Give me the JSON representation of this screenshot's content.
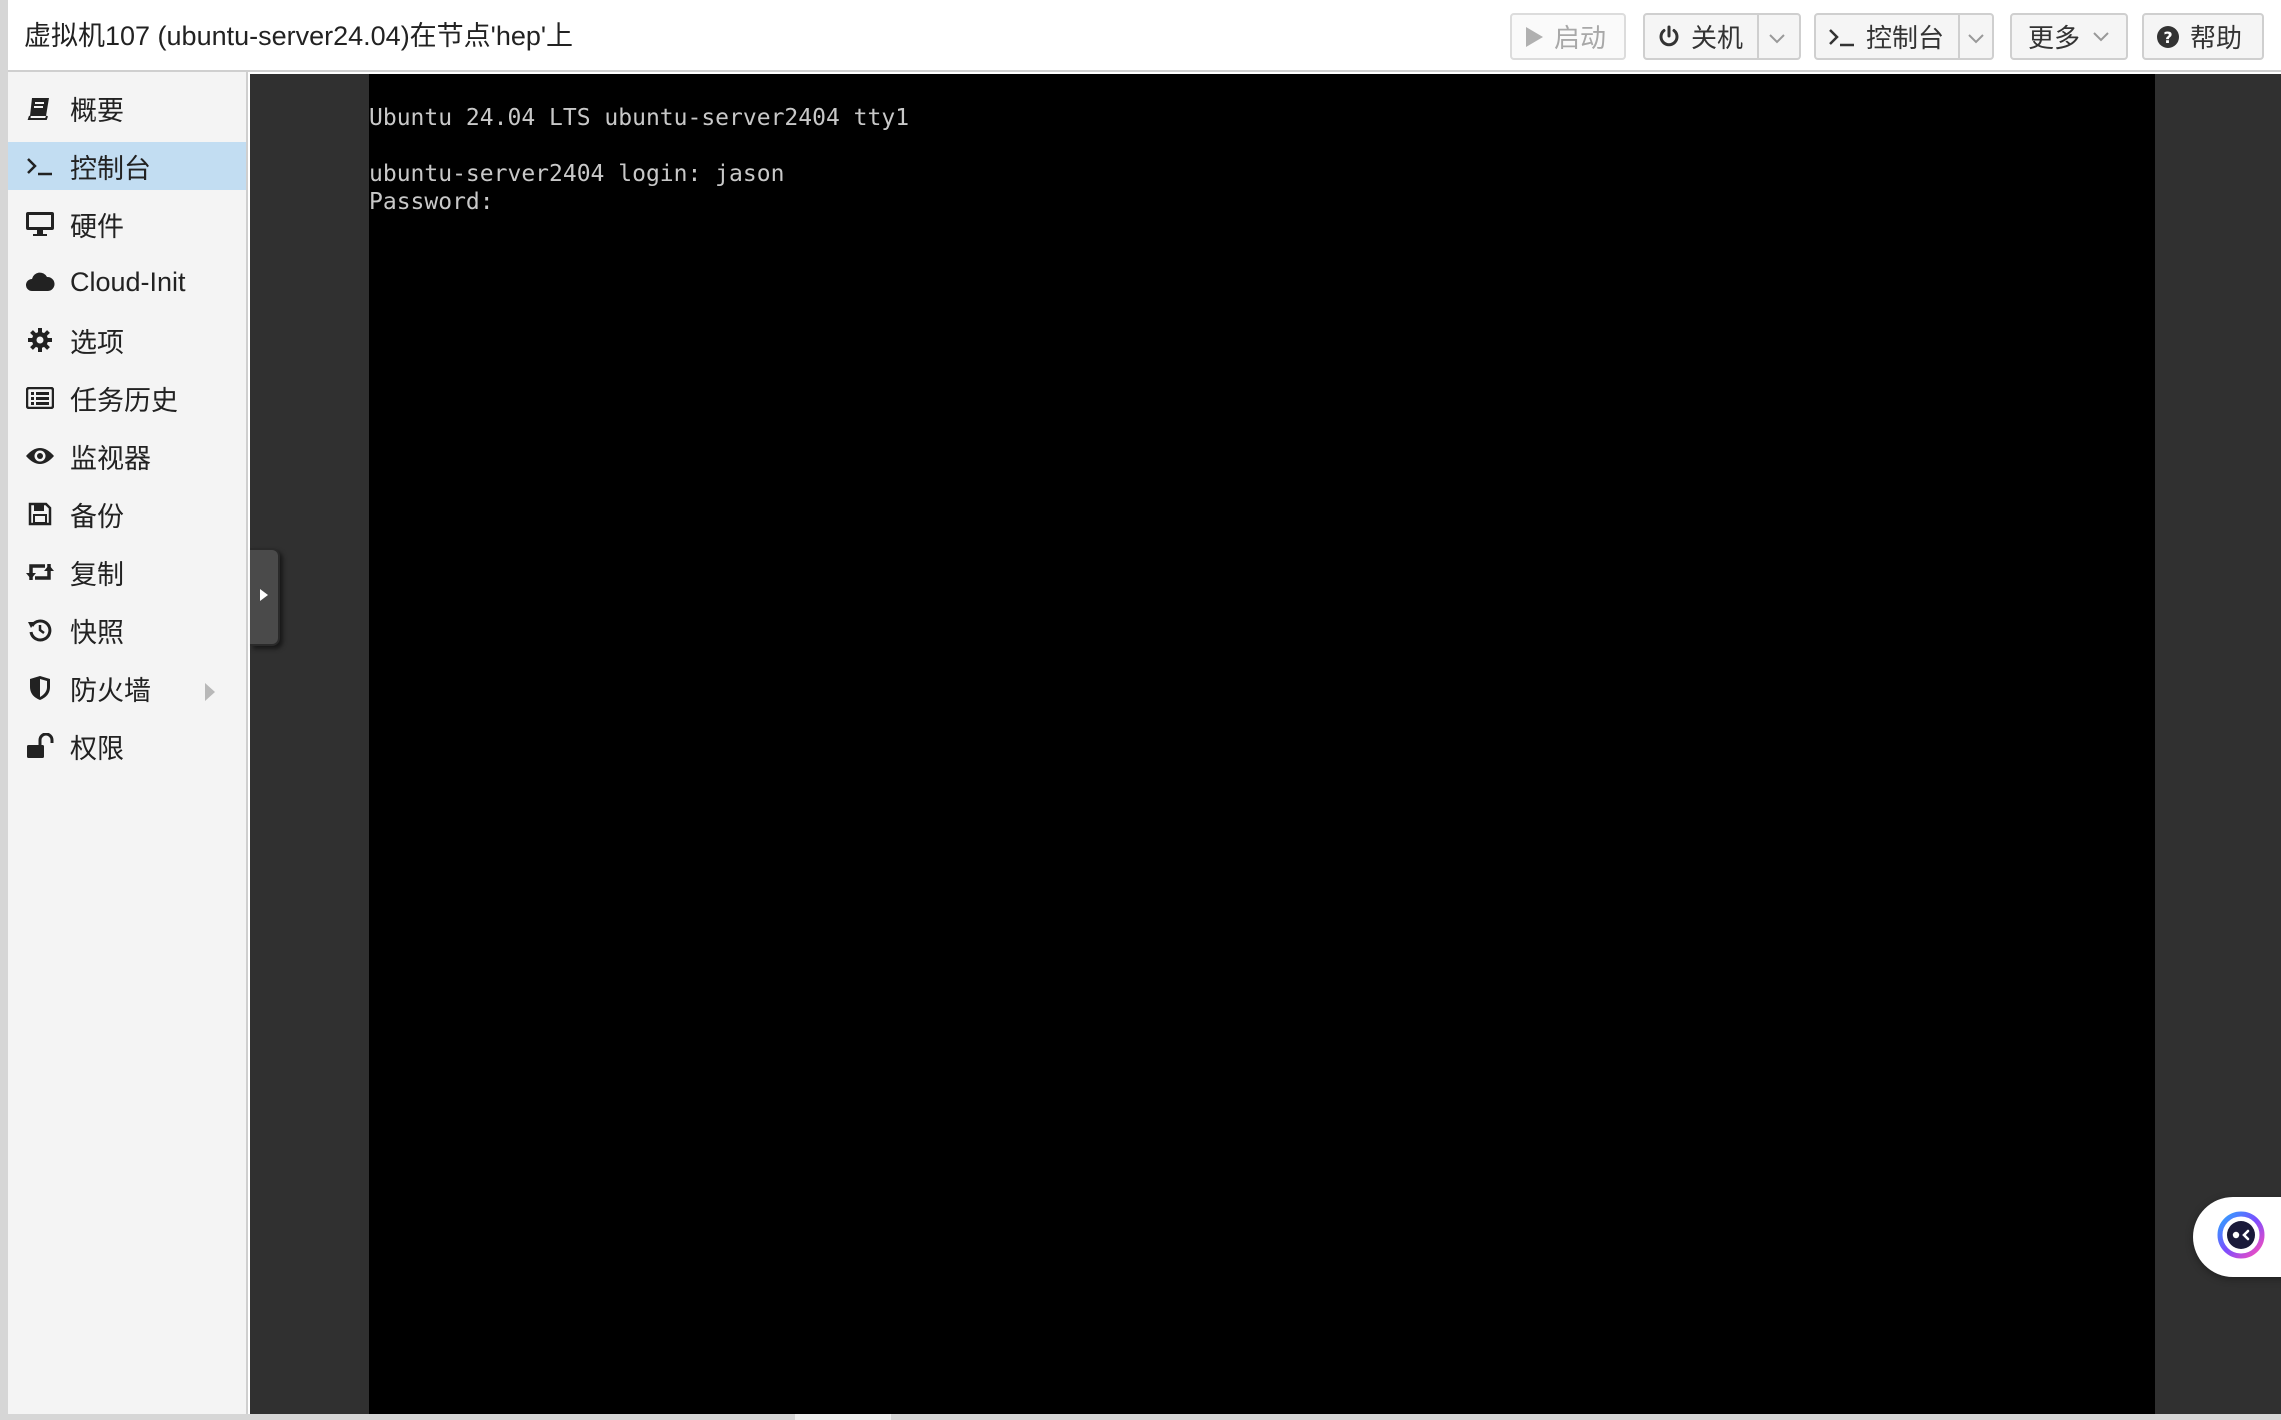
{
  "window": {
    "title": "虚拟机107 (ubuntu-server24.04)在节点'hep'上"
  },
  "toolbar": {
    "start_label": "启动",
    "shutdown_label": "关机",
    "console_label": "控制台",
    "more_label": "更多",
    "help_label": "帮助"
  },
  "sidebar": {
    "active_index": 1,
    "items": [
      {
        "label": "概要",
        "icon": "book-icon"
      },
      {
        "label": "控制台",
        "icon": "terminal-icon"
      },
      {
        "label": "硬件",
        "icon": "desktop-icon"
      },
      {
        "label": "Cloud-Init",
        "icon": "cloud-icon"
      },
      {
        "label": "选项",
        "icon": "gear-icon"
      },
      {
        "label": "任务历史",
        "icon": "list-icon"
      },
      {
        "label": "监视器",
        "icon": "eye-icon"
      },
      {
        "label": "备份",
        "icon": "floppy-icon"
      },
      {
        "label": "复制",
        "icon": "retweet-icon"
      },
      {
        "label": "快照",
        "icon": "history-icon"
      },
      {
        "label": "防火墙",
        "icon": "shield-icon"
      },
      {
        "label": "权限",
        "icon": "unlock-icon"
      }
    ]
  },
  "console": {
    "lines": [
      "Ubuntu 24.04 LTS ubuntu-server2404 tty1",
      "",
      "ubuntu-server2404 login: jason",
      "Password:"
    ]
  },
  "colors": {
    "active_nav_bg": "#c2ddf2",
    "terminal_bg": "#000000",
    "terminal_fg": "#c8c8c8",
    "console_panel_bg": "#303030"
  }
}
